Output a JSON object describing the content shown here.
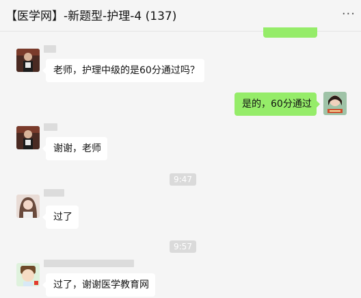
{
  "header": {
    "title": "【医学网】-新题型-护理-4 (137)",
    "more_label": "···"
  },
  "messages": [
    {
      "side": "left",
      "text": "老师，护理中级的是60分通过吗？"
    },
    {
      "side": "right",
      "text": "是的，60分通过"
    },
    {
      "side": "left",
      "text": "谢谢，老师"
    },
    {
      "side": "left",
      "text": "过了"
    },
    {
      "side": "left",
      "text": "过了，谢谢医学教育网"
    }
  ],
  "timestamps": [
    "9:47",
    "9:57"
  ],
  "colors": {
    "self_bubble": "#95ec69",
    "other_bubble": "#ffffff",
    "background": "#f5f5f5"
  },
  "avatars": [
    "avatar-person-dark-icon",
    "avatar-teacher-icon",
    "avatar-woman-icon",
    "avatar-cartoon-icon"
  ]
}
